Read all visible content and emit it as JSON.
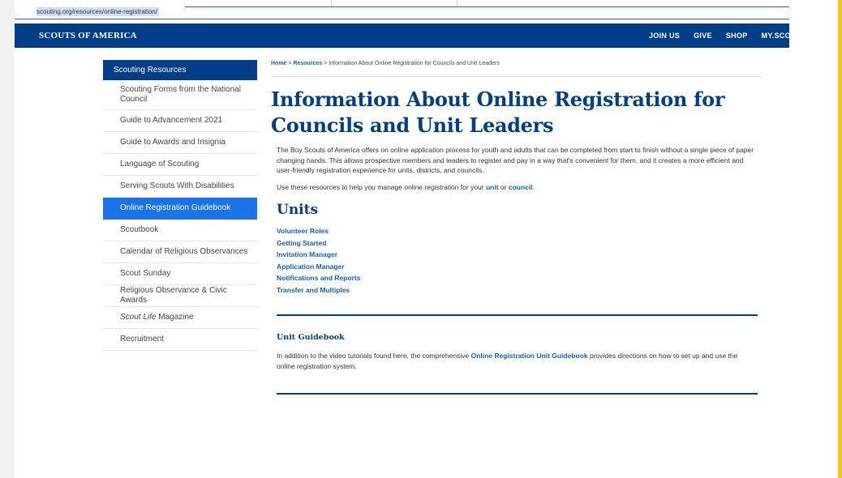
{
  "browser": {
    "url": "scouting.org/resources/online-registration/"
  },
  "header": {
    "brand": "SCOUTS OF AMERICA",
    "nav": [
      "JOIN US",
      "GIVE",
      "SHOP",
      "MY.SCO"
    ]
  },
  "sidebar": {
    "heading": "Scouting Resources",
    "items": [
      {
        "label": "Scouting Forms from the National Council"
      },
      {
        "label": "Guide to Advancement 2021"
      },
      {
        "label": "Guide to Awards and Insignia"
      },
      {
        "label": "Language of Scouting"
      },
      {
        "label": "Serving Scouts With Disabilities"
      },
      {
        "label": "Online Registration Guidebook",
        "active": true
      },
      {
        "label": "Scoutbook"
      },
      {
        "label": "Calendar of Religious Observances"
      },
      {
        "label": "Scout Sunday"
      },
      {
        "label": "Religious Observance & Civic Awards"
      },
      {
        "label_italic": "Scout Life",
        "label_rest": " Magazine"
      },
      {
        "label": "Recruitment"
      }
    ]
  },
  "breadcrumb": {
    "home": "Home",
    "sep": " > ",
    "resources": "Resources",
    "current": "Information About Online Registration for Councils and Unit Leaders"
  },
  "main": {
    "title": "Information About Online Registration for Councils and Unit Leaders",
    "intro": "The Boy Scouts of America offers on online application process for youth and adults that can be completed from start to finish without a single piece of paper changing hands. This allows prospective members and leaders to register and pay in a way that's convenient for them, and it creates a more efficient and user-friendly registration experience for units, districts, and councils.",
    "resources_pre": "Use these resources to help you manage online registration for your ",
    "resources_unit": "unit",
    "resources_or": " or ",
    "resources_council": "council",
    "resources_end": ".",
    "units_heading": "Units",
    "unit_links": [
      "Volunteer Roles",
      "Getting Started",
      "Invitation Manager",
      "Application Manager",
      "Notifications and Reports",
      "Transfer and Multiples"
    ],
    "guidebook_heading": "Unit Guidebook",
    "guidebook_pre": "In addition to the video tutorials found here, the comprehensive ",
    "guidebook_link": "Online Registration Unit Guidebook",
    "guidebook_post": " provides directions on how to set up and use the online registration system."
  },
  "colors": {
    "navy": "#003f87",
    "link": "#1a5fb4",
    "active": "#1a73e8"
  }
}
